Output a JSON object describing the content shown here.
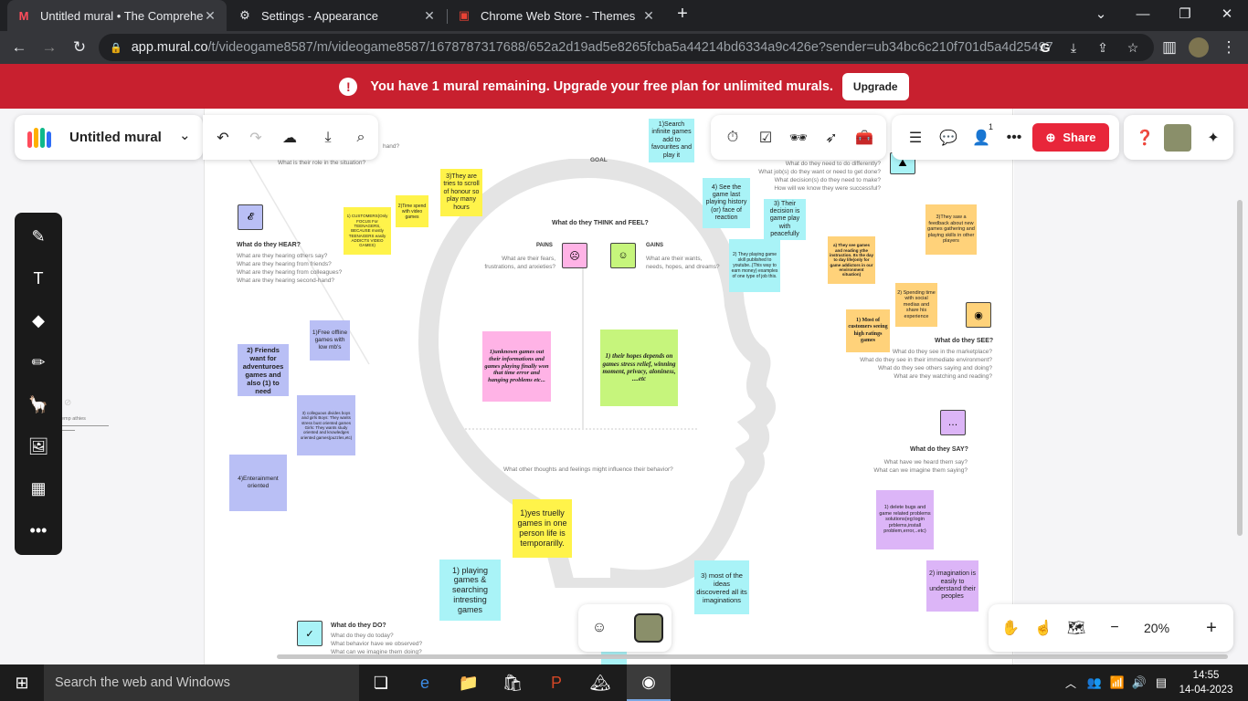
{
  "browser": {
    "tabs": [
      {
        "title": "Untitled mural • The Comprehen",
        "icon": "mural-icon"
      },
      {
        "title": "Settings - Appearance",
        "icon": "gear-icon"
      },
      {
        "title": "Chrome Web Store - Themes",
        "icon": "chrome-web-store-icon"
      }
    ],
    "url_host": "app.mural.co",
    "url_path": "/t/videogame8587/m/videogame8587/1678787317688/652a2d19ad5e8265fcba5a44214bd6334a9c426e?sender=ub34bc6c210f701d5a4d25497"
  },
  "banner": {
    "message": "You have 1 mural remaining. Upgrade your free plan for unlimited murals.",
    "button": "Upgrade"
  },
  "toolbar": {
    "mural_title": "Untitled mural",
    "share": "Share",
    "notification_count": "1"
  },
  "zoom": "20%",
  "board": {
    "goal": "GOAL",
    "think_feel": "What do they THINK and FEEL?",
    "pains": "PAINS",
    "pains_desc": [
      "What are their fears,",
      "frustrations, and anxieties?"
    ],
    "gains": "GAINS",
    "gains_desc": [
      "What are their wants,",
      "needs, hopes, and dreams?"
    ],
    "other_thoughts": "What other thoughts and feelings might influence their behavior?",
    "hear_title": "What do they HEAR?",
    "hear_q": [
      "What are they hearing others say?",
      "What are they hearing from friends?",
      "What are they hearing from colleagues?",
      "What are they hearing second-hand?"
    ],
    "see_title": "What do they SEE?",
    "see_q": [
      "What do they see in the marketplace?",
      "What do they see in their immediate environment?",
      "What do they see others saying and doing?",
      "What are they watching and reading?"
    ],
    "say_title": "What do they SAY?",
    "say_q": [
      "What have we heard them say?",
      "What can we imagine them saying?"
    ],
    "do_title": "What do they DO?",
    "do_q": [
      "What do they do today?",
      "What behavior have we observed?",
      "What can we imagine them doing?"
    ],
    "top_left_q": [
      "hand?",
      "What is their role in the situation?"
    ],
    "top_right_q": [
      "What do they need to do differently?",
      "What job(s) do they want or need to get done?",
      "What decision(s) do they need to make?",
      "How will we know they were successful?"
    ],
    "left_edge_label": "emp athies"
  },
  "stickies": {
    "search_infinite": "1)Search infinite games add to favourites and play it",
    "tries_scroll": "3)They are tries to scroll of honour so play many hours",
    "time_spend": "2)Time spend with video games",
    "customers": "1) CUSTOMERS(Only FOCUS For TEENAGERS, BECAUSE mostly TEENAGERS easily ADDICTS VIDEO GAMES)",
    "see_game": "4) See the game last playing history (or) face of reaction",
    "their_decision": "3) Their decision is game play with peacefully",
    "played_youtube": "2) They playing game skill published to youtube..(This way to earn money) examples of one type of job this.",
    "see_games_reading": "a) They see games and reading ythe instruction. Its the day to day life(only for game addictors in our environment situation)",
    "feedback": "3)They saw a feedback about new games gathering and playing skills in other players",
    "spending_time": "2) Spending time with social medias and share his experience",
    "most_customers": "1) Most of customers seeing high ratings games",
    "free_offline": "1)Free offline games with low mb's",
    "friends_want": "2) Friends want for adventuroes games and also (1) to need",
    "colleagues": "3) colleguous divides boys and girls Boys: They wants stress bust oriented games Girls: They wants study oriented and knowledges oriented games(puzzles,etc)",
    "entertainment": "4)Enterainment oriented",
    "unknown_games": "1)unknown games out their informations and games playing finally won that time error and hanging problems etc...",
    "hopes": "1) their hopes depends on games stress relief, winning moment, privacy, aloniness, ....etc",
    "yes_truelly": "1)yes truelly games in one person life is temporarilly.",
    "playing_searching": "1) playing games & searching intresting games",
    "most_ideas": "3) most of the ideas discovered all its imaginations",
    "delete_bugs": "1) delete bugs and game related problems solutions(eg:login prblems,install problem,error,..etc)",
    "imagination": "2) imagination is easily to understand their peoples"
  },
  "taskbar": {
    "search": "Search the web and Windows",
    "time": "14:55",
    "date": "14-04-2023"
  }
}
